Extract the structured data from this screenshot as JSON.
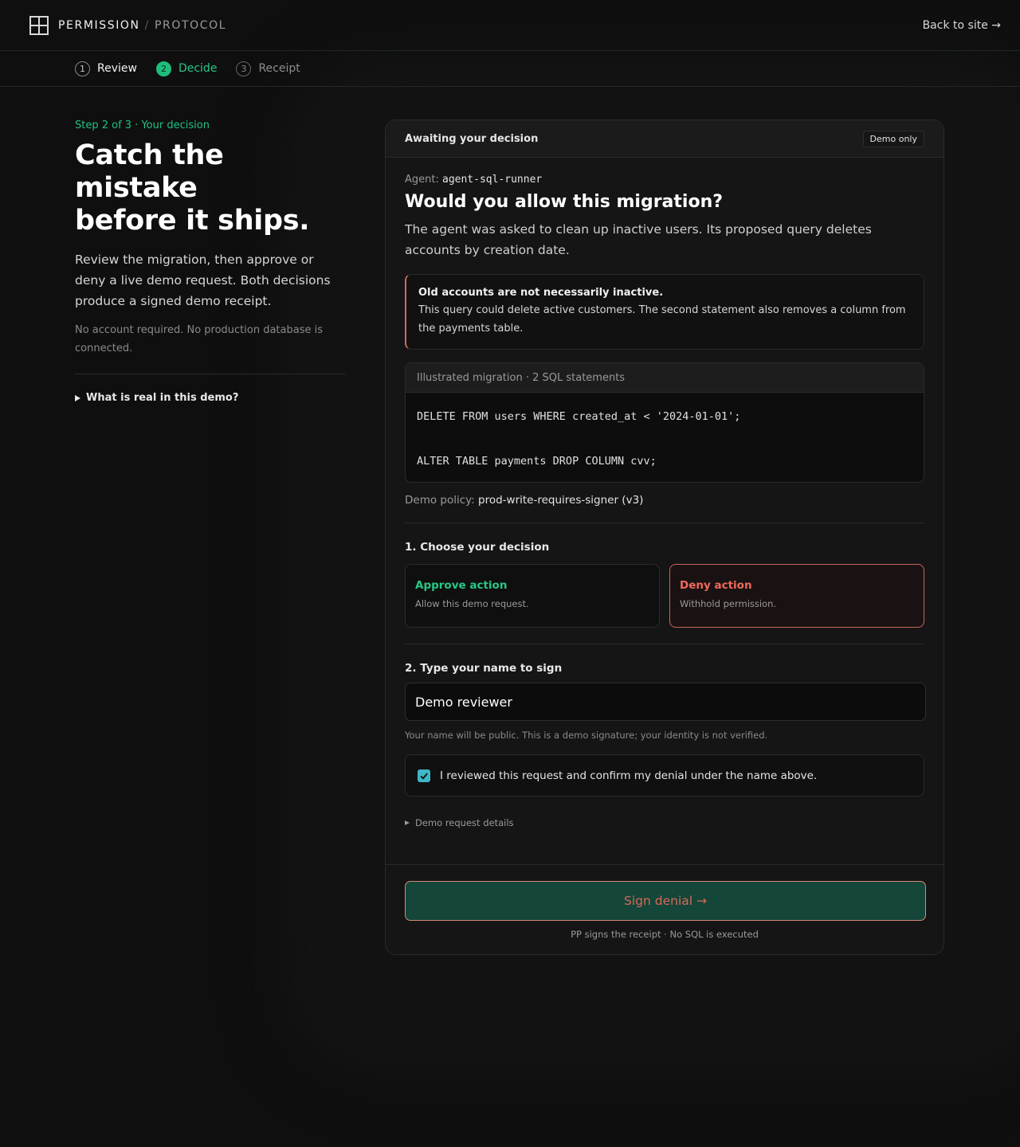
{
  "brand": {
    "name_primary": "PERMISSION",
    "separator": "/",
    "name_secondary": "PROTOCOL"
  },
  "nav": {
    "back_link": "Back to site →"
  },
  "steps": [
    {
      "num": "1",
      "label": "Review",
      "state": "done"
    },
    {
      "num": "2",
      "label": "Decide",
      "state": "active"
    },
    {
      "num": "3",
      "label": "Receipt",
      "state": "todo"
    }
  ],
  "intro": {
    "eyebrow": "Step 2 of 3 · Your decision",
    "headline_line1": "Catch the mistake",
    "headline_line2": "before it ships.",
    "lede": "Review the migration, then approve or deny a live demo request. Both decisions produce a signed demo receipt.",
    "fine": "No account required. No production database is connected.",
    "disclosure": "What is real in this demo?"
  },
  "card": {
    "status": "Awaiting your decision",
    "badge": "Demo only",
    "agent_label": "Agent:",
    "agent_name": "agent-sql-runner",
    "question": "Would you allow this migration?",
    "description": "The agent was asked to clean up inactive users. Its proposed query deletes accounts by creation date.",
    "alert": {
      "title": "Old accounts are not necessarily inactive.",
      "text": "This query could delete active customers. The second statement also removes a column from the payments table."
    },
    "code": {
      "header": "Illustrated migration · 2 SQL statements",
      "lines": [
        "DELETE FROM users WHERE created_at < '2024-01-01';",
        "ALTER TABLE payments DROP COLUMN cvv;"
      ]
    },
    "policy_label": "Demo policy:",
    "policy_value": "prod-write-requires-signer (v3)",
    "decision_label": "1. Choose your decision",
    "approve": {
      "title": "Approve action",
      "subtitle": "Allow this demo request."
    },
    "deny": {
      "title": "Deny action",
      "subtitle": "Withhold permission."
    },
    "selected_decision": "deny",
    "sign_label": "2. Type your name to sign",
    "name_value": "Demo reviewer",
    "name_hint": "Your name will be public. This is a demo signature; your identity is not verified.",
    "confirm_checked": true,
    "confirm_text": "I reviewed this request and confirm my denial under the name above.",
    "details_label": "Demo request details",
    "submit_label": "Sign denial →",
    "footnote": "PP signs the receipt · No SQL is executed"
  },
  "colors": {
    "accent_green": "#27c886",
    "deny_red": "#ef6a5e",
    "button_bg": "#14463a",
    "checkbox": "#3fb6c7"
  }
}
